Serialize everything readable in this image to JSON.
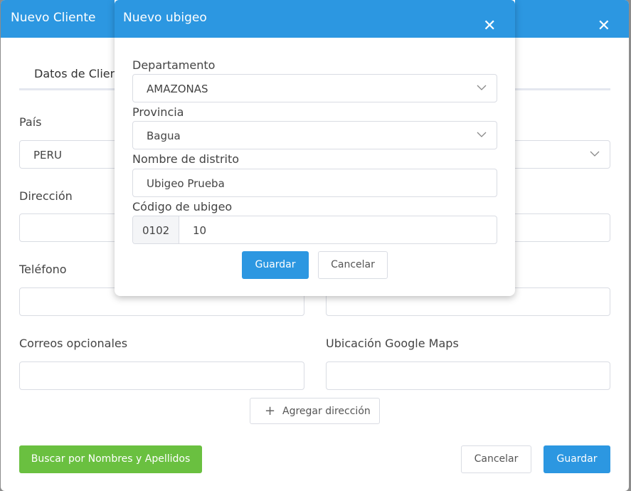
{
  "outer_modal": {
    "title": "Nuevo Cliente",
    "tab_label": "Datos de Cliente",
    "pais_label": "País",
    "pais_value": "PERU",
    "direccion_label": "Dirección",
    "telefono_label": "Teléfono",
    "correos_label": "Correos opcionales",
    "ubicacion_label": "Ubicación Google Maps",
    "add_address_label": "Agregar dirección",
    "search_names_label": "Buscar por Nombres y Apellidos",
    "cancel_label": "Cancelar",
    "save_label": "Guardar"
  },
  "inner_modal": {
    "title": "Nuevo ubigeo",
    "departamento_label": "Departamento",
    "departamento_value": "AMAZONAS",
    "provincia_label": "Provincia",
    "provincia_value": "Bagua",
    "distrito_label": "Nombre de distrito",
    "distrito_value": "Ubigeo Prueba",
    "codigo_label": "Código de ubigeo",
    "codigo_prefix": "0102",
    "codigo_value": "10",
    "save_label": "Guardar",
    "cancel_label": "Cancelar"
  },
  "colors": {
    "header_blue": "#2c97e1",
    "green": "#6ac040"
  }
}
